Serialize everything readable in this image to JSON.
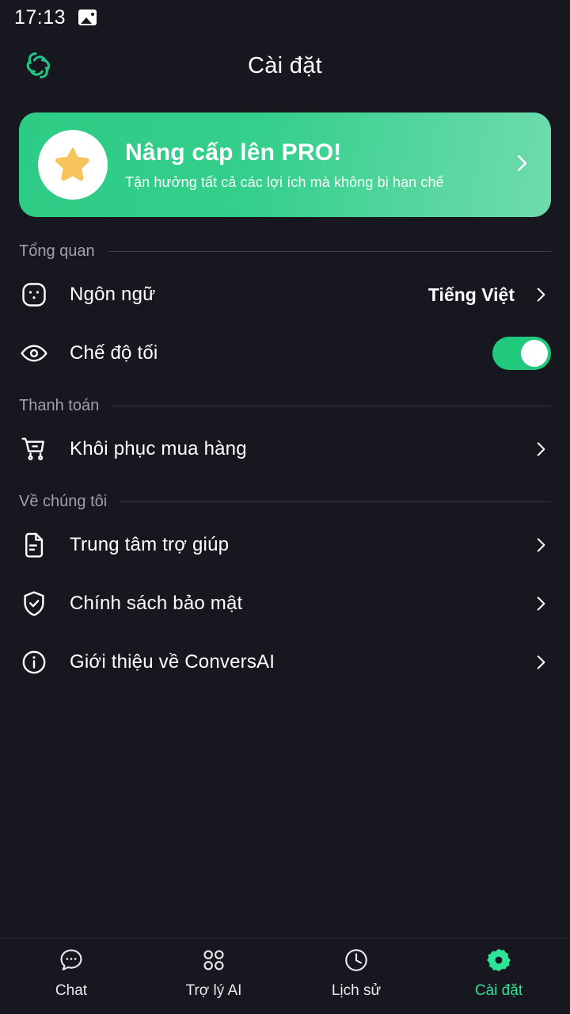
{
  "statusbar": {
    "time": "17:13",
    "image_icon": "image-icon"
  },
  "header": {
    "title": "Cài đặt",
    "logo_icon": "conversai-logo-icon"
  },
  "pro_banner": {
    "title": "Nâng cấp lên PRO!",
    "subtitle": "Tận hưởng tất cả các lợi ích mà không bị hạn chế",
    "star_icon": "star-icon",
    "chevron_icon": "chevron-right-icon",
    "gradient_start": "#2dcb84",
    "gradient_end": "#6fdcae"
  },
  "sections": [
    {
      "label": "Tổng quan",
      "rows": [
        {
          "icon": "language-icon",
          "label": "Ngôn ngữ",
          "value": "Tiếng Việt",
          "control": "chevron"
        },
        {
          "icon": "eye-icon",
          "label": "Chế độ tối",
          "value": "",
          "control": "toggle",
          "toggle_on": true
        }
      ]
    },
    {
      "label": "Thanh toán",
      "rows": [
        {
          "icon": "shopping-cart-icon",
          "label": "Khôi phục mua hàng",
          "value": "",
          "control": "chevron"
        }
      ]
    },
    {
      "label": "Về chúng tôi",
      "rows": [
        {
          "icon": "file-text-icon",
          "label": "Trung tâm trợ giúp",
          "value": "",
          "control": "chevron"
        },
        {
          "icon": "shield-check-icon",
          "label": "Chính sách bảo mật",
          "value": "",
          "control": "chevron"
        },
        {
          "icon": "info-circle-icon",
          "label": "Giới thiệu về ConversAI",
          "value": "",
          "control": "chevron"
        }
      ]
    }
  ],
  "bottom_nav": {
    "active_color": "#2ee397",
    "items": [
      {
        "label": "Chat",
        "icon": "chat-bubble-icon",
        "active": false
      },
      {
        "label": "Trợ lý AI",
        "icon": "grid-apps-icon",
        "active": false
      },
      {
        "label": "Lịch sử",
        "icon": "clock-icon",
        "active": false
      },
      {
        "label": "Cài đặt",
        "icon": "gear-icon",
        "active": true
      }
    ]
  }
}
